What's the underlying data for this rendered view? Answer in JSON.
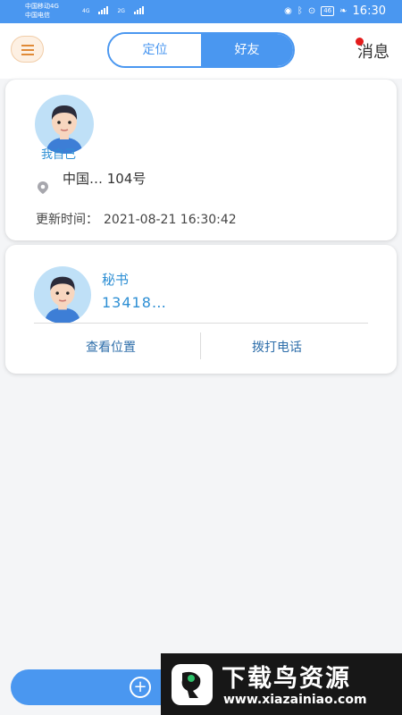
{
  "status_bar": {
    "carrier1": "中国移动4G",
    "carrier2": "中国电信",
    "net1": "4G",
    "net2": "2G",
    "battery": "46",
    "time": "16:30"
  },
  "header": {
    "tabs": [
      {
        "label": "定位",
        "active": false
      },
      {
        "label": "好友",
        "active": true
      }
    ],
    "messages_label": "消息",
    "icons": {
      "menu": "list-menu-icon",
      "badge": "red-dot"
    },
    "colors": {
      "accent": "#4a97f0",
      "menu_bg": "#fdf0e3",
      "badge": "#e31b1b"
    }
  },
  "me_card": {
    "label": "我自己",
    "address": "中国… 104号",
    "updated_label": "更新时间：",
    "updated_time": "2021-08-21 16:30:42"
  },
  "friends": [
    {
      "name": "秘书",
      "phone": "13418…",
      "actions": [
        "查看位置",
        "拨打电话"
      ]
    }
  ],
  "watermark": {
    "title": "下载鸟资源",
    "url": "www.xiazainiao.com"
  }
}
